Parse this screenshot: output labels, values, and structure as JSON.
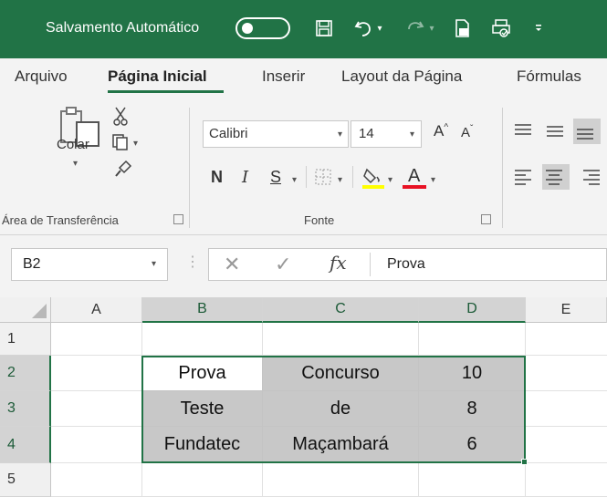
{
  "titlebar": {
    "autosave_label": "Salvamento Automático",
    "autosave_state": "off",
    "background": "#217346"
  },
  "tabs": [
    {
      "label": "Arquivo",
      "active": false
    },
    {
      "label": "Página Inicial",
      "active": true
    },
    {
      "label": "Inserir",
      "active": false
    },
    {
      "label": "Layout da Página",
      "active": false
    },
    {
      "label": "Fórmulas",
      "active": false
    }
  ],
  "ribbon": {
    "clipboard": {
      "paste_label": "Colar",
      "group_label": "Área de Transferência",
      "icons": [
        "paste-icon",
        "cut-icon",
        "copy-icon",
        "format-painter-icon"
      ]
    },
    "font": {
      "font_name": "Calibri",
      "font_size": "14",
      "grow_label": "A",
      "shrink_label": "A",
      "bold_label": "N",
      "italic_label": "I",
      "underline_label": "S",
      "font_color_label": "A",
      "highlight_color": "#ffff00",
      "font_color": "#e81123",
      "group_label": "Fonte"
    },
    "alignment_icons": [
      "align-top-icon",
      "align-middle-icon",
      "align-bottom-icon",
      "align-left-icon",
      "align-center-icon",
      "align-right-icon"
    ]
  },
  "formula_bar": {
    "name_box": "B2",
    "fx_label": "fx",
    "value": "Prova"
  },
  "sheet": {
    "columns": [
      "A",
      "B",
      "C",
      "D",
      "E"
    ],
    "rows": [
      "1",
      "2",
      "3",
      "4",
      "5"
    ],
    "selected_range": "B2:D4",
    "cells": [
      [
        "Prova",
        "Concurso",
        "10"
      ],
      [
        "Teste",
        "de",
        "8"
      ],
      [
        "Fundatec",
        "Maçambará",
        "6"
      ]
    ],
    "selection_color": "#217346"
  }
}
